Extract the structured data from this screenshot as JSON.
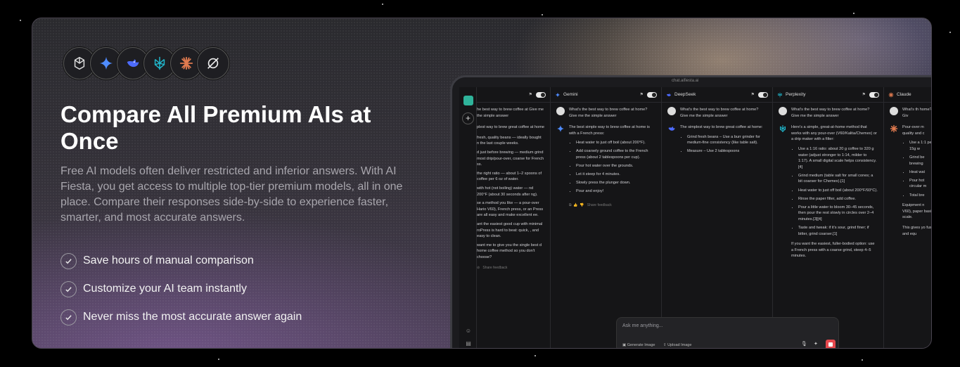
{
  "hero": {
    "title": "Compare All Premium AIs at Once",
    "description": "Free AI models often deliver restricted and inferior answers. With AI Fiesta, you get access to multiple top-tier premium models, all in one place. Compare their responses side-by-side to experience faster, smarter, and most accurate answers.",
    "features": [
      "Save hours of manual comparison",
      "Customize your AI team instantly",
      "Never miss the most accurate answer again"
    ],
    "logos": [
      "openai-icon",
      "gemini-icon",
      "deepseek-icon",
      "perplexity-icon",
      "claude-icon",
      "grok-icon"
    ]
  },
  "mockup": {
    "url": "chat.aifiesta.ai",
    "question": "What's the best way to brew coffee at home? Give me the simple answer",
    "share_feedback": "Share feedback",
    "composer": {
      "placeholder": "Ask me anything...",
      "generate_image": "Generate Image",
      "upload_image": "Upload Image"
    },
    "columns": {
      "first": {
        "q": "he best way to brew coffee at Give me the simple answer",
        "intro": "plest way to brew great coffee at home",
        "items": [
          "fresh, quality beans — ideally bought n the last couple weeks.",
          "d just before brewing — medium grind most drip/pour-over, coarse for French ss.",
          "the right ratio — about 1–2 spoons of coffee per 6 oz of water.",
          "with hot (not boiling) water — nd 200°F (about 30 seconds after ng).",
          "se a method you like — a pour-over Hario V60), French press, or an Press are all easy and make excellent ee."
        ],
        "outro1": "ant the easiest good cup with minimal roPress is hard to beat: quick, , and easy to clean.",
        "outro2": "want me to give you the single best d home coffee method so you don't choose?"
      },
      "gemini": {
        "name": "Gemini",
        "intro": "The best simple way to brew coffee at home is with a French press:",
        "items": [
          "Heat water to just off boil (about 200°F).",
          "Add coarsely ground coffee to the French press (about 2 tablespoons per cup).",
          "Pour hot water over the grounds.",
          "Let it steep for 4 minutes.",
          "Slowly press the plunger down.",
          "Pour and enjoy!"
        ]
      },
      "deepseek": {
        "name": "DeepSeek",
        "intro": "The simplest way to brew great coffee at home:",
        "items": [
          "Grind fresh beans – Use a burr grinder for medium-fine consistency (like table salt).",
          "Measure – Use 2 tablespoons"
        ]
      },
      "perplexity": {
        "name": "Perplexity",
        "intro": "Here's a simple, great-at-home method that works with any pour-over (V60/Kalita/Chemex) or a drip maker with a filter:",
        "items": [
          "Use a 1:16 ratio: about 20 g coffee to 320 g water (adjust stronger to 1:14, milder to 1:17). A small digital scale helps consistency.[4]",
          "Grind medium (table salt for small cones; a bit coarser for Chemex).[1]",
          "Heat water to just off boil (about 200°F/93°C).",
          "Rinse the paper filter, add coffee.",
          "Pour a little water to bloom 30–45 seconds, then pour the rest slowly in circles over 2–4 minutes.[3][4]",
          "Taste and tweak: if it's sour, grind finer; if bitter, grind coarser.[1]"
        ],
        "outro": "If you want the easiest, fuller-bodied option: use a French press with a coarse grind, steep 4–5 minutes."
      },
      "claude": {
        "name": "Claude",
        "q": "What's th home? Giv",
        "intro": "Pour-over m quality and c",
        "items": [
          "Use a 1:1 per 15g w",
          "Grind be brewing",
          "Heat wat",
          "Pour hot circular m",
          "Total bre"
        ],
        "outro1": "Equipment n V60), paper basic scale.",
        "outro2": "This gives yo fuss and equ"
      }
    }
  }
}
